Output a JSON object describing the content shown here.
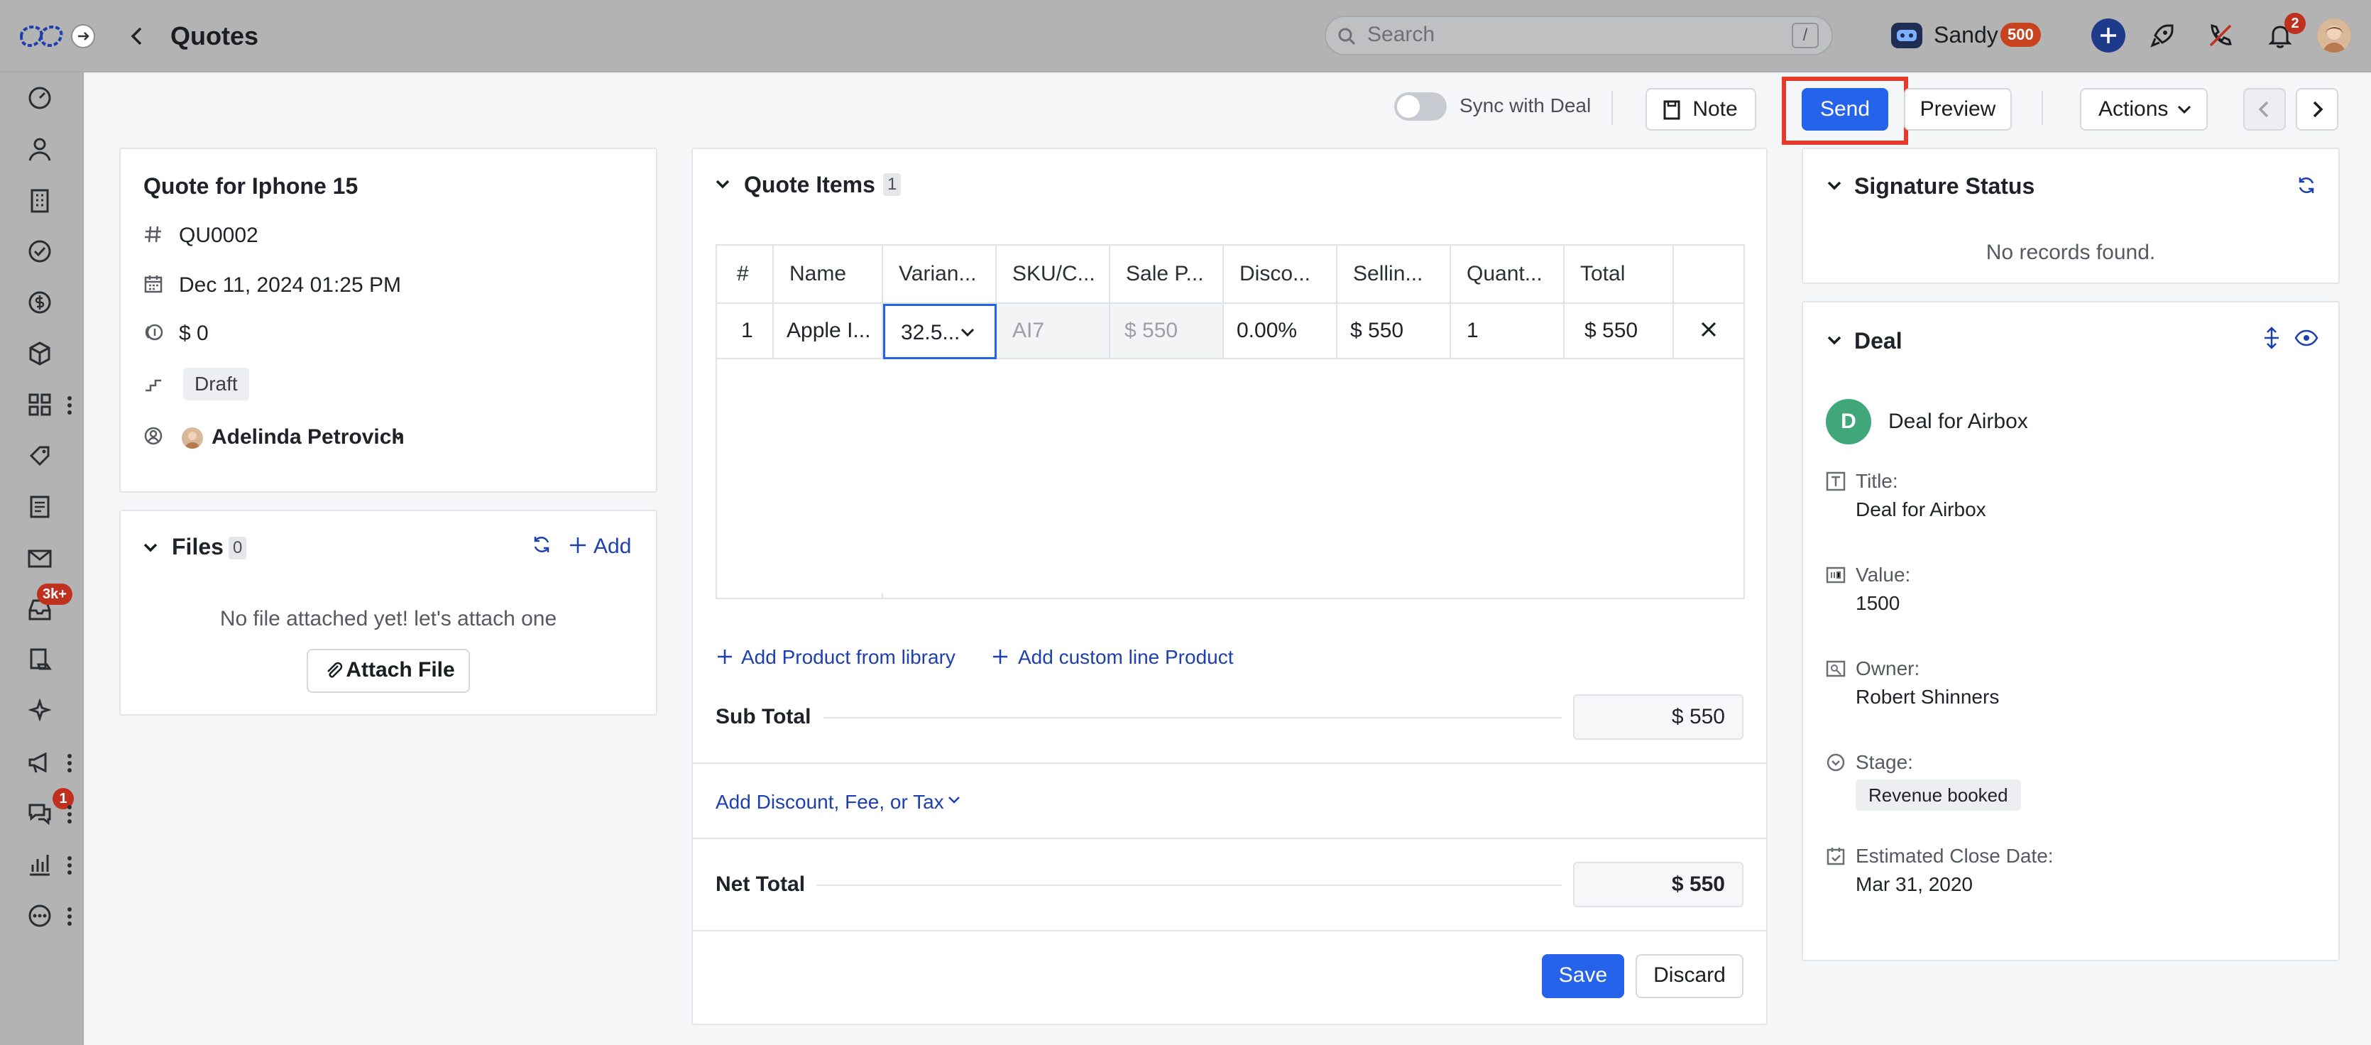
{
  "topbar": {
    "page_title": "Quotes",
    "search_placeholder": "Search",
    "search_shortcut": "/",
    "user_name": "Sandy",
    "user_points": "500",
    "notification_count": "2"
  },
  "sidebar": {
    "inbox_badge": "3k+",
    "chat_badge": "1"
  },
  "toolbar": {
    "sync_label": "Sync with Deal",
    "note_label": "Note",
    "send_label": "Send",
    "preview_label": "Preview",
    "actions_label": "Actions"
  },
  "quote": {
    "title": "Quote for Iphone 15",
    "number": "QU0002",
    "date": "Dec 11, 2024 01:25 PM",
    "amount": "$ 0",
    "status": "Draft",
    "owner": "Adelinda Petrovich"
  },
  "files": {
    "title": "Files",
    "count": "0",
    "add_label": "Add",
    "empty_text": "No file attached yet! let's attach one",
    "attach_label": "Attach File"
  },
  "quote_items": {
    "title": "Quote Items",
    "count": "1",
    "columns": [
      "#",
      "Name",
      "Varian...",
      "SKU/C...",
      "Sale P...",
      "Disco...",
      "Sellin...",
      "Quant...",
      "Total"
    ],
    "rows": [
      {
        "num": "1",
        "name": "Apple I...",
        "variant": "32.5...",
        "sku": "AI7",
        "sale_price": "$ 550",
        "discount": "0.00%",
        "selling_price": "$ 550",
        "quantity": "1",
        "total": "$ 550"
      }
    ],
    "add_library_label": "Add Product from library",
    "add_custom_label": "Add custom line Product",
    "subtotal_label": "Sub Total",
    "subtotal_value": "$ 550",
    "discount_link": "Add Discount, Fee, or Tax",
    "net_total_label": "Net Total",
    "net_total_value": "$ 550",
    "save_label": "Save",
    "discard_label": "Discard"
  },
  "signature": {
    "title": "Signature Status",
    "empty_text": "No records found."
  },
  "deal": {
    "title": "Deal",
    "avatar_letter": "D",
    "name": "Deal for Airbox",
    "fields": {
      "title_label": "Title:",
      "title_value": "Deal for Airbox",
      "value_label": "Value:",
      "value_value": "1500",
      "owner_label": "Owner:",
      "owner_value": "Robert Shinners",
      "stage_label": "Stage:",
      "stage_value": "Revenue booked",
      "close_label": "Estimated Close Date:",
      "close_value": "Mar 31, 2020"
    }
  },
  "colors": {
    "primary": "#2563eb",
    "highlight": "#e53b2c",
    "deal_avatar": "#3fa77a",
    "badge": "#c0301e"
  }
}
